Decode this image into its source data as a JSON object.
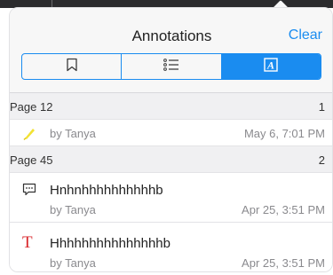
{
  "header": {
    "title": "Annotations",
    "clear_label": "Clear"
  },
  "segments": [
    {
      "icon": "bookmark-icon",
      "selected": false
    },
    {
      "icon": "list-icon",
      "selected": false
    },
    {
      "icon": "annotation-a-icon",
      "selected": true,
      "glyph": "A"
    }
  ],
  "sections": [
    {
      "page_label": "Page 12",
      "count": "1",
      "items": [
        {
          "type": "highlight",
          "icon": "highlighter-icon",
          "author": "by Tanya",
          "date": "May 6, 7:01 PM"
        }
      ]
    },
    {
      "page_label": "Page 45",
      "count": "2",
      "items": [
        {
          "type": "comment",
          "icon": "comment-icon",
          "text": "Hnhnhhhhhhhhhhb",
          "author": "by Tanya",
          "date": "Apr 25, 3:51 PM"
        },
        {
          "type": "text",
          "icon": "text-t-icon",
          "glyph": "T",
          "text": "Hhhhhhhhhhhhhhhb",
          "author": "by Tanya",
          "date": "Apr 25, 3:51 PM"
        }
      ]
    }
  ],
  "colors": {
    "accent": "#1a8cf0",
    "highlighter": "#f2e233",
    "text_icon": "#d9262b"
  }
}
